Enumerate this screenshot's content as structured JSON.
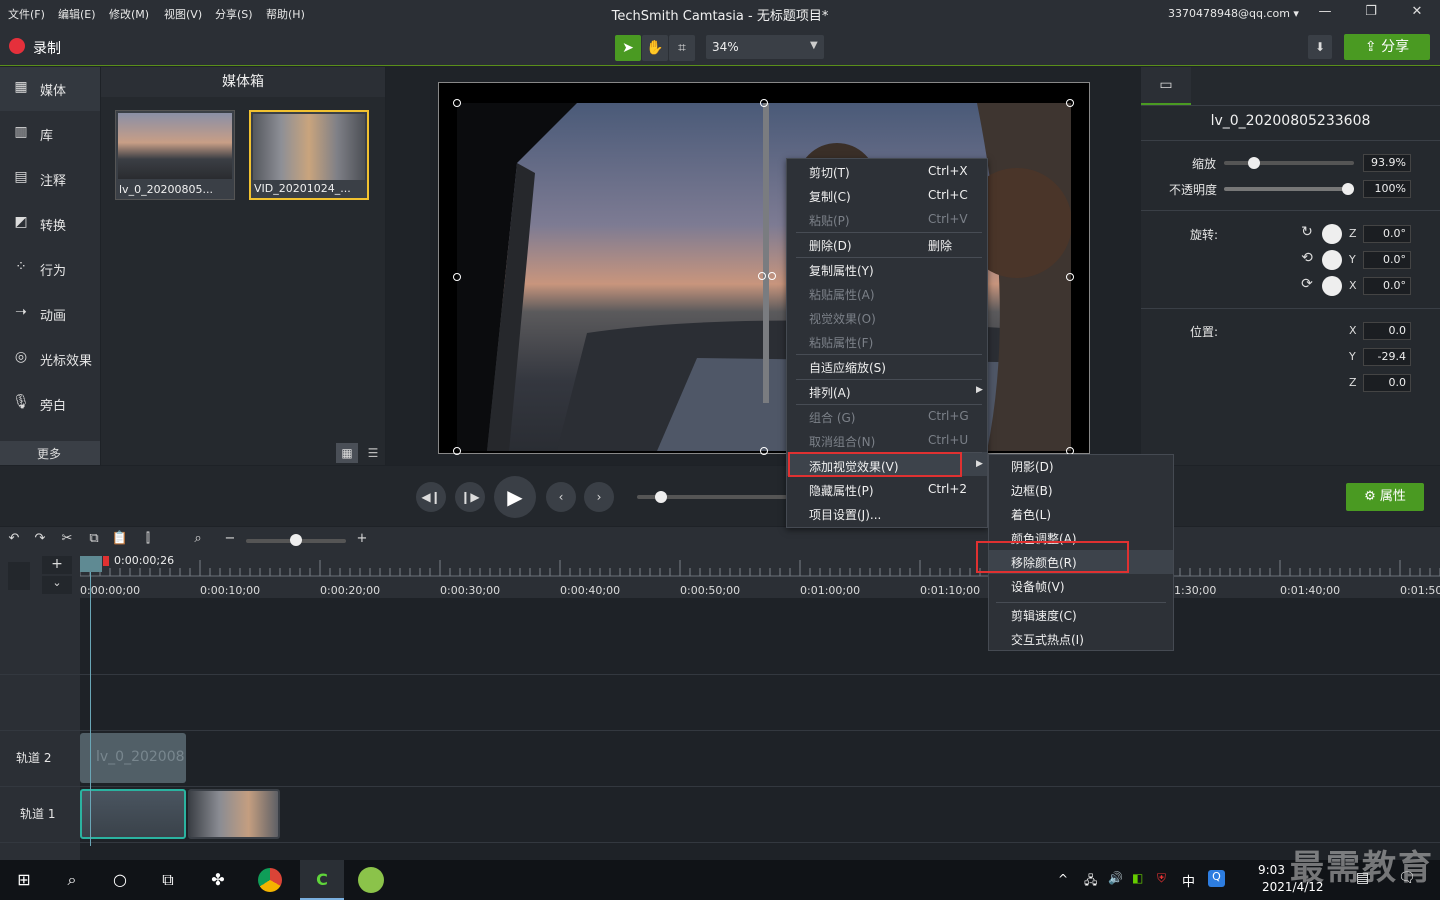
{
  "menubar": {
    "items": [
      "文件(F)",
      "编辑(E)",
      "修改(M)",
      "视图(V)",
      "分享(S)",
      "帮助(H)"
    ],
    "title": "TechSmith Camtasia - 无标题项目*",
    "account": "3370478948@qq.com ▾"
  },
  "toolbar": {
    "record": "录制",
    "zoom": "34%",
    "share": "分享"
  },
  "rail": {
    "items": [
      "媒体",
      "库",
      "注释",
      "转换",
      "行为",
      "动画",
      "光标效果",
      "旁白"
    ],
    "more": "更多"
  },
  "bin": {
    "title": "媒体箱",
    "clips": [
      "lv_0_20200805...",
      "VID_20201024_..."
    ]
  },
  "props": {
    "clip_name": "lv_0_20200805233608",
    "scale_label": "缩放",
    "scale_value": "93.9%",
    "scale_level": 0.2,
    "opacity_label": "不透明度",
    "opacity_value": "100%",
    "opacity_level": 1.0,
    "rotation_label": "旋转:",
    "rotation": [
      {
        "axis": "Z",
        "value": "0.0°"
      },
      {
        "axis": "Y",
        "value": "0.0°"
      },
      {
        "axis": "X",
        "value": "0.0°"
      }
    ],
    "position_label": "位置:",
    "position": [
      {
        "axis": "X",
        "value": "0.0"
      },
      {
        "axis": "Y",
        "value": "-29.4"
      },
      {
        "axis": "Z",
        "value": "0.0"
      }
    ],
    "attr_button": "属性"
  },
  "timeline": {
    "playhead_time": "0:00:00;26",
    "ticks": [
      "0:00:00;00",
      "0:00:10;00",
      "0:00:20;00",
      "0:00:30;00",
      "0:00:40;00",
      "0:00:50;00",
      "0:01:00;00",
      "0:01:10;00",
      "1:30;00",
      "0:01:40;00",
      "0:01:50;"
    ],
    "tracks": [
      "轨道 2",
      "轨道 1"
    ],
    "track2_clip": "lv_0_202008"
  },
  "context_menu": {
    "items": [
      {
        "label": "剪切(T)",
        "shortcut": "Ctrl+X",
        "disabled": false
      },
      {
        "label": "复制(C)",
        "shortcut": "Ctrl+C",
        "disabled": false
      },
      {
        "label": "粘贴(P)",
        "shortcut": "Ctrl+V",
        "disabled": true
      },
      {
        "label": "删除(D)",
        "shortcut": "删除",
        "disabled": false
      },
      {
        "label": "复制属性(Y)",
        "shortcut": "",
        "disabled": false
      },
      {
        "label": "粘贴属性(A)",
        "shortcut": "",
        "disabled": true
      },
      {
        "label": "视觉效果(O)",
        "shortcut": "",
        "disabled": true
      },
      {
        "label": "粘贴属性(F)",
        "shortcut": "",
        "disabled": true
      },
      {
        "label": "自适应缩放(S)",
        "shortcut": "",
        "disabled": false
      },
      {
        "label": "排列(A)",
        "shortcut": "",
        "disabled": false
      },
      {
        "label": "组合 (G)",
        "shortcut": "Ctrl+G",
        "disabled": true
      },
      {
        "label": "取消组合(N)",
        "shortcut": "Ctrl+U",
        "disabled": true
      },
      {
        "label": "添加视觉效果(V)",
        "shortcut": "",
        "disabled": false
      },
      {
        "label": "隐藏属性(P)",
        "shortcut": "Ctrl+2",
        "disabled": false
      },
      {
        "label": "项目设置(J)...",
        "shortcut": "",
        "disabled": false
      }
    ],
    "submenu": [
      "阴影(D)",
      "边框(B)",
      "着色(L)",
      "颜色调整(A)",
      "移除颜色(R)",
      "设备帧(V)",
      "剪辑速度(C)",
      "交互式热点(I)"
    ]
  },
  "taskbar": {
    "time": "9:03",
    "date": "2021/4/12",
    "ime": "中"
  },
  "watermark": "最需教育"
}
